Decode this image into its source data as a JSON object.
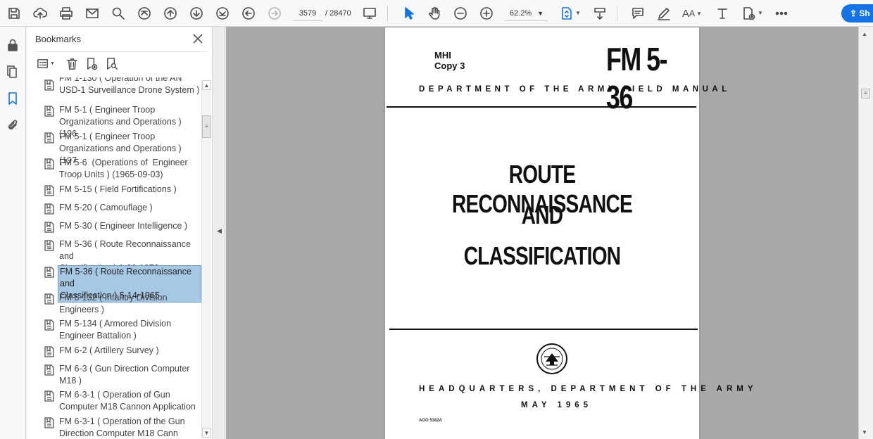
{
  "toolbar": {
    "current_page": "3579",
    "total_pages": "/ 28470",
    "zoom": "62.2%",
    "share_label": "Sh"
  },
  "panel": {
    "title": "Bookmarks"
  },
  "bookmarks": [
    {
      "label": "FM 1-130 ( Operation of the AN\nUSD-1 Surveillance Drone System )"
    },
    {
      "label": "FM 5-1 ( Engineer Troop\nOrganizations and Operations ) (196"
    },
    {
      "label": "FM 5-1 ( Engineer Troop\nOrganizations and Operations ) (197"
    },
    {
      "label": "FM 5-6  (Operations of  Engineer\nTroop Units ) (1965-09-03)"
    },
    {
      "label": "FM 5-15 ( Field Fortifications )"
    },
    {
      "label": "FM 5-20 ( Camouflage )"
    },
    {
      "label": "FM 5-30 ( Engineer Intelligence )"
    },
    {
      "label": "FM 5-36 ( Route Reconnaissance and\nClassification ) 1-20-1972"
    },
    {
      "label": "FM 5-36 ( Route Reconnaissance and\nClassification ) 5-14-1965",
      "selected": true
    },
    {
      "label": "FM 5-132 ( Infantry Division\nEngineers )"
    },
    {
      "label": "FM 5-134 ( Armored Division\nEngineer Battalion )"
    },
    {
      "label": "FM 6-2 ( Artillery Survey )"
    },
    {
      "label": "FM 6-3 ( Gun Direction Computer\nM18 )"
    },
    {
      "label": "FM 6-3-1 ( Operation of Gun\nComputer M18 Cannon Application"
    },
    {
      "label": "FM 6-3-1 ( Operation of the Gun\nDirection Computer M18 Cann"
    }
  ],
  "document": {
    "mhi": "MHI",
    "copy": "Copy 3",
    "fm_number": "FM 5-36",
    "department_line": "DEPARTMENT OF THE ARMY FIELD MANUAL",
    "title_1": "ROUTE RECONNAISSANCE",
    "title_2": "AND",
    "title_3": "CLASSIFICATION",
    "hq_line": "HEADQUARTERS, DEPARTMENT OF THE ARMY",
    "date": "MAY 1965",
    "footer_code": "AGO 5382A"
  },
  "icons": {
    "save": "save-icon",
    "upload": "cloud-upload-icon",
    "print": "print-icon",
    "email": "email-icon",
    "search": "search-icon",
    "first": "first-page-icon",
    "prev": "previous-page-icon",
    "next": "next-page-icon",
    "last": "last-page-icon",
    "back": "back-icon",
    "forward": "forward-icon",
    "display": "display-mode-icon",
    "select": "select-arrow-icon",
    "hand": "hand-icon",
    "zoom_out": "zoom-out-icon",
    "zoom_in": "zoom-in-icon",
    "fit": "fit-page-icon",
    "scroll": "scroll-mode-icon",
    "comment": "comment-icon",
    "pen": "pen-icon",
    "text_size": "text-size-icon",
    "text": "add-text-icon",
    "fill_sign": "fill-sign-icon",
    "more": "more-icon"
  }
}
